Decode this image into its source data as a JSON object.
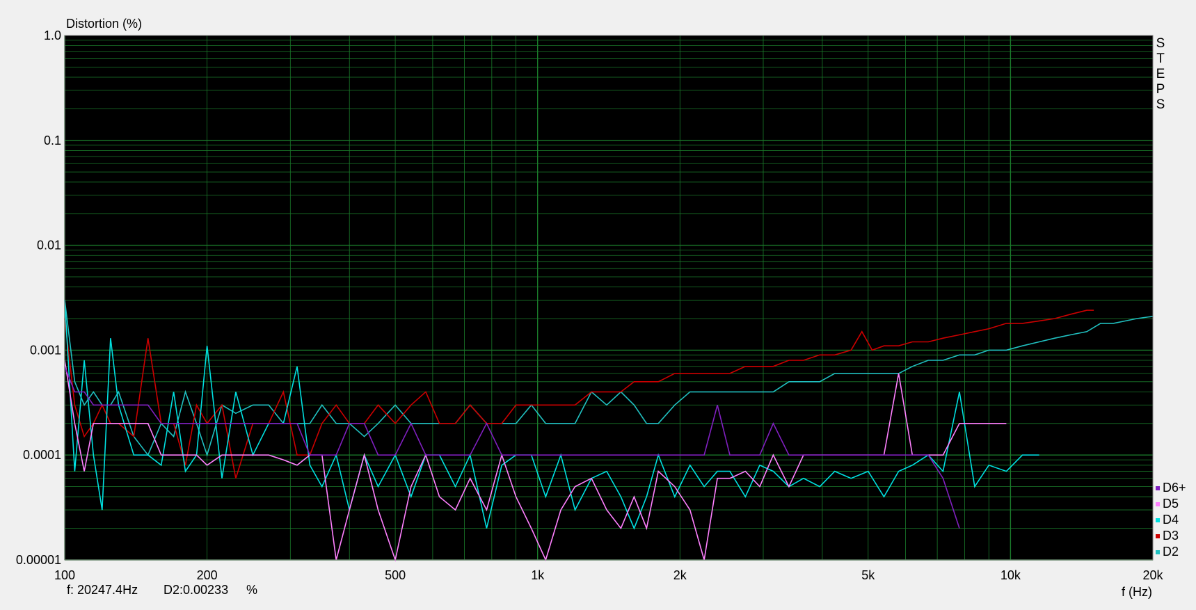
{
  "chart_data": {
    "type": "line",
    "ylabel": "Distortion (%)",
    "xlabel": "f (Hz)",
    "x_scale": "log",
    "y_scale": "log",
    "xlim": [
      100,
      20000
    ],
    "ylim": [
      1e-05,
      1.0
    ],
    "x_ticks": [
      {
        "value": 100,
        "label": "100"
      },
      {
        "value": 200,
        "label": "200"
      },
      {
        "value": 500,
        "label": "500"
      },
      {
        "value": 1000,
        "label": "1k"
      },
      {
        "value": 2000,
        "label": "2k"
      },
      {
        "value": 5000,
        "label": "5k"
      },
      {
        "value": 10000,
        "label": "10k"
      },
      {
        "value": 20000,
        "label": "20k"
      }
    ],
    "y_ticks": [
      {
        "value": 1.0,
        "label": "1.0"
      },
      {
        "value": 0.1,
        "label": "0.1"
      },
      {
        "value": 0.01,
        "label": "0.01"
      },
      {
        "value": 0.001,
        "label": "0.001"
      },
      {
        "value": 0.0001,
        "label": "0.0001"
      },
      {
        "value": 1e-05,
        "label": "0.00001"
      }
    ],
    "grid": true,
    "background": "#000000",
    "grid_color": "#1a7a2a",
    "legend_position": "bottom-right",
    "series": [
      {
        "name": "D2",
        "color": "#20c0c0",
        "x": [
          100,
          105,
          110,
          115,
          120,
          125,
          130,
          140,
          150,
          160,
          170,
          180,
          190,
          200,
          215,
          230,
          250,
          270,
          290,
          310,
          330,
          350,
          375,
          400,
          430,
          460,
          500,
          540,
          580,
          620,
          670,
          720,
          780,
          840,
          900,
          970,
          1040,
          1120,
          1200,
          1300,
          1400,
          1500,
          1600,
          1700,
          1800,
          1950,
          2100,
          2250,
          2400,
          2550,
          2750,
          2950,
          3150,
          3400,
          3650,
          3950,
          4250,
          4600,
          5000,
          5400,
          5800,
          6200,
          6700,
          7200,
          7800,
          8400,
          9000,
          9800,
          10600,
          11500,
          12400,
          13400,
          14500,
          15500,
          16500,
          17500,
          18500,
          20000
        ],
        "y": [
          0.003,
          0.0005,
          0.0003,
          0.0004,
          0.0003,
          0.0003,
          0.0004,
          0.00015,
          0.0001,
          0.0002,
          0.00015,
          0.0004,
          0.0002,
          0.0001,
          0.0003,
          0.00025,
          0.0003,
          0.0003,
          0.0002,
          0.0002,
          0.0002,
          0.0003,
          0.0002,
          0.0002,
          0.00015,
          0.0002,
          0.0003,
          0.0002,
          0.0002,
          0.0002,
          0.0002,
          0.0003,
          0.0002,
          0.0002,
          0.0002,
          0.0003,
          0.0002,
          0.0002,
          0.0002,
          0.0004,
          0.0003,
          0.0004,
          0.0003,
          0.0002,
          0.0002,
          0.0003,
          0.0004,
          0.0004,
          0.0004,
          0.0004,
          0.0004,
          0.0004,
          0.0004,
          0.0005,
          0.0005,
          0.0005,
          0.0006,
          0.0006,
          0.0006,
          0.0006,
          0.0006,
          0.0007,
          0.0008,
          0.0008,
          0.0009,
          0.0009,
          0.001,
          0.001,
          0.0011,
          0.0012,
          0.0013,
          0.0014,
          0.0015,
          0.0018,
          0.0018,
          0.0019,
          0.002,
          0.0021
        ]
      },
      {
        "name": "D3",
        "color": "#cc0000",
        "x": [
          100,
          105,
          110,
          115,
          120,
          125,
          130,
          140,
          150,
          160,
          170,
          180,
          190,
          200,
          215,
          230,
          250,
          270,
          290,
          310,
          330,
          350,
          375,
          400,
          430,
          460,
          500,
          540,
          580,
          620,
          670,
          720,
          780,
          840,
          900,
          970,
          1040,
          1120,
          1200,
          1300,
          1400,
          1500,
          1600,
          1700,
          1800,
          1950,
          2100,
          2250,
          2400,
          2550,
          2750,
          2950,
          3150,
          3400,
          3650,
          3950,
          4250,
          4600,
          4850,
          5100,
          5400,
          5800,
          6200,
          6700,
          7200,
          7800,
          8400,
          9000,
          9800,
          10600,
          11500,
          12400,
          13400,
          14500,
          15000
        ],
        "y": [
          0.002,
          0.0003,
          0.00015,
          0.0002,
          0.0003,
          0.0002,
          0.0002,
          0.00015,
          0.0013,
          0.0002,
          0.0002,
          8e-05,
          0.0003,
          0.0002,
          0.0003,
          6e-05,
          0.0002,
          0.0002,
          0.0004,
          0.0001,
          0.0001,
          0.0002,
          0.0003,
          0.0002,
          0.0002,
          0.0003,
          0.0002,
          0.0003,
          0.0004,
          0.0002,
          0.0002,
          0.0003,
          0.0002,
          0.0002,
          0.0003,
          0.0003,
          0.0003,
          0.0003,
          0.0003,
          0.0004,
          0.0004,
          0.0004,
          0.0005,
          0.0005,
          0.0005,
          0.0006,
          0.0006,
          0.0006,
          0.0006,
          0.0006,
          0.0007,
          0.0007,
          0.0007,
          0.0008,
          0.0008,
          0.0009,
          0.0009,
          0.001,
          0.0015,
          0.001,
          0.0011,
          0.0011,
          0.0012,
          0.0012,
          0.0013,
          0.0014,
          0.0015,
          0.0016,
          0.0018,
          0.0018,
          0.0019,
          0.002,
          0.0022,
          0.0024,
          0.0024
        ]
      },
      {
        "name": "D4",
        "color": "#00e0e0",
        "x": [
          100,
          105,
          110,
          115,
          120,
          125,
          130,
          140,
          150,
          160,
          170,
          180,
          190,
          200,
          215,
          230,
          250,
          270,
          290,
          310,
          330,
          350,
          375,
          400,
          430,
          460,
          500,
          540,
          580,
          620,
          670,
          720,
          780,
          840,
          900,
          970,
          1040,
          1120,
          1200,
          1300,
          1400,
          1500,
          1600,
          1700,
          1800,
          1950,
          2100,
          2250,
          2400,
          2550,
          2750,
          2950,
          3150,
          3400,
          3650,
          3950,
          4250,
          4600,
          5000,
          5400,
          5800,
          6200,
          6700,
          7200,
          7800,
          8400,
          9000,
          9800,
          10600,
          11500
        ],
        "y": [
          0.003,
          7e-05,
          0.0008,
          0.0001,
          3e-05,
          0.0013,
          0.0003,
          0.0001,
          0.0001,
          8e-05,
          0.0004,
          7e-05,
          0.0001,
          0.0011,
          6e-05,
          0.0004,
          0.0001,
          0.0002,
          0.0002,
          0.0007,
          8e-05,
          5e-05,
          0.0001,
          3e-05,
          0.0001,
          5e-05,
          0.0001,
          4e-05,
          0.0001,
          0.0001,
          5e-05,
          0.0001,
          2e-05,
          8e-05,
          0.0001,
          0.0001,
          4e-05,
          0.0001,
          3e-05,
          6e-05,
          7e-05,
          4e-05,
          2e-05,
          4e-05,
          0.0001,
          4e-05,
          8e-05,
          5e-05,
          7e-05,
          7e-05,
          4e-05,
          8e-05,
          7e-05,
          5e-05,
          6e-05,
          5e-05,
          7e-05,
          6e-05,
          7e-05,
          4e-05,
          7e-05,
          8e-05,
          0.0001,
          7e-05,
          0.0004,
          5e-05,
          8e-05,
          7e-05,
          0.0001,
          0.0001
        ]
      },
      {
        "name": "D5",
        "color": "#ff80ff",
        "x": [
          100,
          105,
          110,
          115,
          120,
          125,
          130,
          140,
          150,
          160,
          170,
          180,
          190,
          200,
          215,
          230,
          250,
          270,
          290,
          310,
          330,
          350,
          375,
          400,
          430,
          460,
          500,
          540,
          580,
          620,
          670,
          720,
          780,
          840,
          900,
          970,
          1040,
          1120,
          1200,
          1300,
          1400,
          1500,
          1600,
          1700,
          1800,
          1950,
          2100,
          2250,
          2400,
          2550,
          2750,
          2950,
          3150,
          3400,
          3650,
          3950,
          4250,
          4600,
          5000,
          5400,
          5800,
          6200,
          6700,
          7200,
          7800,
          8400,
          9000,
          9800
        ],
        "y": [
          0.0008,
          0.0002,
          7e-05,
          0.0002,
          0.0002,
          0.0002,
          0.0002,
          0.0002,
          0.0002,
          0.0001,
          0.0001,
          0.0001,
          0.0001,
          8e-05,
          0.0001,
          0.0001,
          0.0001,
          0.0001,
          9e-05,
          8e-05,
          0.0001,
          0.0001,
          1e-05,
          3e-05,
          0.0001,
          3e-05,
          1e-05,
          5e-05,
          0.0001,
          4e-05,
          3e-05,
          6e-05,
          3e-05,
          0.0001,
          4e-05,
          2e-05,
          1e-05,
          3e-05,
          5e-05,
          6e-05,
          3e-05,
          2e-05,
          4e-05,
          2e-05,
          7e-05,
          5e-05,
          3e-05,
          1e-05,
          6e-05,
          6e-05,
          7e-05,
          5e-05,
          0.0001,
          5e-05,
          0.0001,
          0.0001,
          0.0001,
          0.0001,
          0.0001,
          0.0001,
          0.0006,
          0.0001,
          0.0001,
          0.0001,
          0.0002,
          0.0002,
          0.0002,
          0.0002
        ]
      },
      {
        "name": "D6+",
        "color": "#8020c0",
        "x": [
          100,
          105,
          110,
          115,
          120,
          125,
          130,
          140,
          150,
          160,
          170,
          180,
          190,
          200,
          215,
          230,
          250,
          270,
          290,
          310,
          330,
          350,
          375,
          400,
          430,
          460,
          500,
          540,
          580,
          620,
          670,
          720,
          780,
          840,
          900,
          970,
          1040,
          1120,
          1200,
          1300,
          1400,
          1500,
          1600,
          1700,
          1800,
          1950,
          2100,
          2250,
          2400,
          2550,
          2750,
          2950,
          3150,
          3400,
          3650,
          3950,
          4250,
          4600,
          5000,
          5400,
          5800,
          6200,
          6700,
          7200,
          7800
        ],
        "y": [
          0.0007,
          0.0004,
          0.0004,
          0.0003,
          0.0003,
          0.0003,
          0.0003,
          0.0003,
          0.0003,
          0.0002,
          0.0002,
          0.0002,
          0.0002,
          0.0002,
          0.0002,
          0.0002,
          0.0002,
          0.0002,
          0.0002,
          0.0002,
          0.0001,
          0.0001,
          0.0001,
          0.0002,
          0.0002,
          0.0001,
          0.0001,
          0.0002,
          0.0001,
          0.0001,
          0.0001,
          0.0001,
          0.0002,
          0.0001,
          0.0001,
          0.0001,
          0.0001,
          0.0001,
          0.0001,
          0.0001,
          0.0001,
          0.0001,
          0.0001,
          0.0001,
          0.0001,
          0.0001,
          0.0001,
          0.0001,
          0.0003,
          0.0001,
          0.0001,
          0.0001,
          0.0002,
          0.0001,
          0.0001,
          0.0001,
          0.0001,
          0.0001,
          0.0001,
          0.0001,
          0.0001,
          0.0001,
          0.0001,
          6e-05,
          2e-05
        ]
      }
    ],
    "legend": [
      {
        "label": "D6+",
        "color": "#8020c0"
      },
      {
        "label": "D5",
        "color": "#ff80ff"
      },
      {
        "label": "D4",
        "color": "#00e0e0"
      },
      {
        "label": "D3",
        "color": "#cc0000"
      },
      {
        "label": "D2",
        "color": "#20c0c0"
      }
    ]
  },
  "steps_label": [
    "S",
    "T",
    "E",
    "P",
    "S"
  ],
  "status": {
    "frequency": "f: 20247.4Hz",
    "reading": "D2:0.00233",
    "unit": "%"
  }
}
